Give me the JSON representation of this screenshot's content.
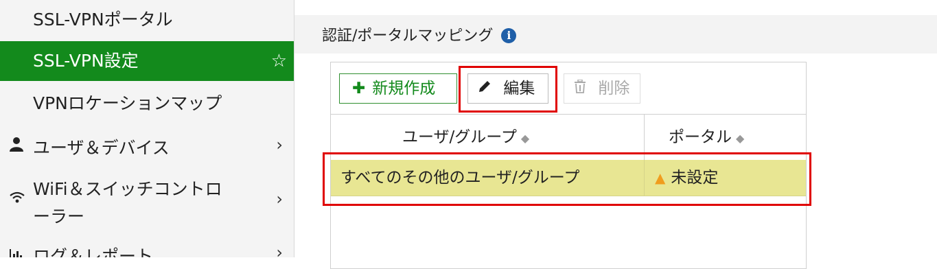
{
  "sidebar": {
    "items": [
      {
        "label": "SSL-VPNポータル",
        "active": false
      },
      {
        "label": "SSL-VPN設定",
        "active": true,
        "icon": "star-outline-icon"
      },
      {
        "label": "VPNロケーションマップ",
        "active": false
      }
    ],
    "sections": [
      {
        "label": "ユーザ＆デバイス",
        "icon": "user-icon"
      },
      {
        "label_line1": "WiFi＆スイッチコントロ",
        "label_line2": "ーラー",
        "icon": "wifi-icon"
      },
      {
        "label": "ログ＆レポート",
        "icon": "bar-chart-icon"
      }
    ]
  },
  "main": {
    "section_title": "認証/ポータルマッピング",
    "toolbar": {
      "new_label": "新規作成",
      "edit_label": "編集",
      "delete_label": "削除"
    },
    "table": {
      "columns": [
        "ユーザ/グループ",
        "ポータル"
      ],
      "rows": [
        {
          "user_group": "すべてのその他のユーザ/グループ",
          "portal": "未設定",
          "portal_status": "warning"
        }
      ]
    }
  },
  "colors": {
    "active_green": "#138a1c",
    "row_highlight": "#e8e693",
    "annotation_red": "#e00000",
    "warning": "#f09d1e"
  }
}
